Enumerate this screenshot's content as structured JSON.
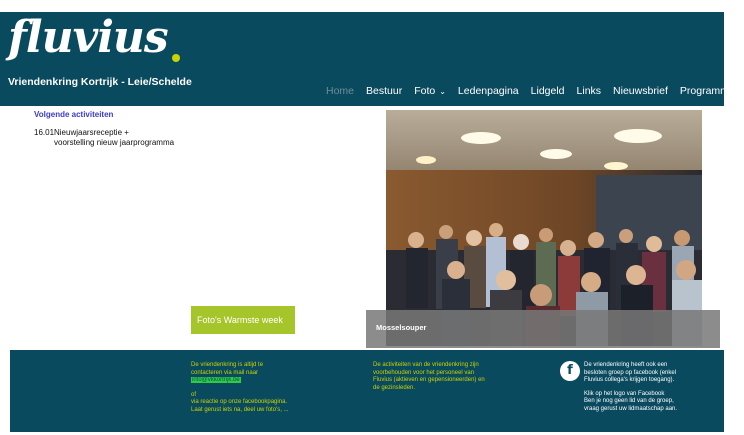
{
  "header": {
    "logo_text": "fluvius",
    "tagline": "Vriendenkring Kortrijk - Leie/Schelde"
  },
  "nav": {
    "items": [
      {
        "label": "Home",
        "active": true,
        "has_dropdown": false
      },
      {
        "label": "Bestuur",
        "active": false,
        "has_dropdown": false
      },
      {
        "label": "Foto",
        "active": false,
        "has_dropdown": true
      },
      {
        "label": "Ledenpagina",
        "active": false,
        "has_dropdown": false
      },
      {
        "label": "Lidgeld",
        "active": false,
        "has_dropdown": false
      },
      {
        "label": "Links",
        "active": false,
        "has_dropdown": false
      },
      {
        "label": "Nieuwsbrief",
        "active": false,
        "has_dropdown": false
      },
      {
        "label": "Programma",
        "active": false,
        "has_dropdown": true
      }
    ],
    "dropdown_glyph": "⌄"
  },
  "sidebar": {
    "title": "Volgende activiteiten",
    "events": [
      {
        "date": "16.01",
        "line1": "Nieuwjaarsreceptie +",
        "line2": "voorstelling nieuw jaarprogramma"
      }
    ]
  },
  "photo": {
    "caption": "Mosselsouper"
  },
  "promo_button": {
    "label": "Foto's Warmste week"
  },
  "footer": {
    "col1": {
      "line1": "De vriendenkring is altijd te",
      "line2": "contacteren via mail naar",
      "email": "info@vkkortrijk.be",
      "line3": "of",
      "line4": "via reactie op onze facebookpagina.",
      "line5": "Laat gerust iets na, deel uw foto's, ..."
    },
    "col2": {
      "line1": "De activiteiten van de vriendenkring zijn",
      "line2": "voorbehouden voor het personeel van",
      "line3": "Fluvius (aktieven en gepensioneerden) en",
      "line4": "de gezinsleden."
    },
    "col3": {
      "fb_glyph": "f",
      "line1": "De vriendenkring heeft ook een",
      "line2": "besloten groep op facebook (enkel",
      "line3": "Fluvius collega's krijgen toegang).",
      "line4": "Klik op het logo van Facebook",
      "line5": "Ben je nog geen lid van de groep,",
      "line6": "vraag gerust uw lidmaatschap aan."
    }
  },
  "colors": {
    "brand": "#0a4a5f",
    "accent_yellow": "#c8d400",
    "button_green": "#a6c52a"
  }
}
